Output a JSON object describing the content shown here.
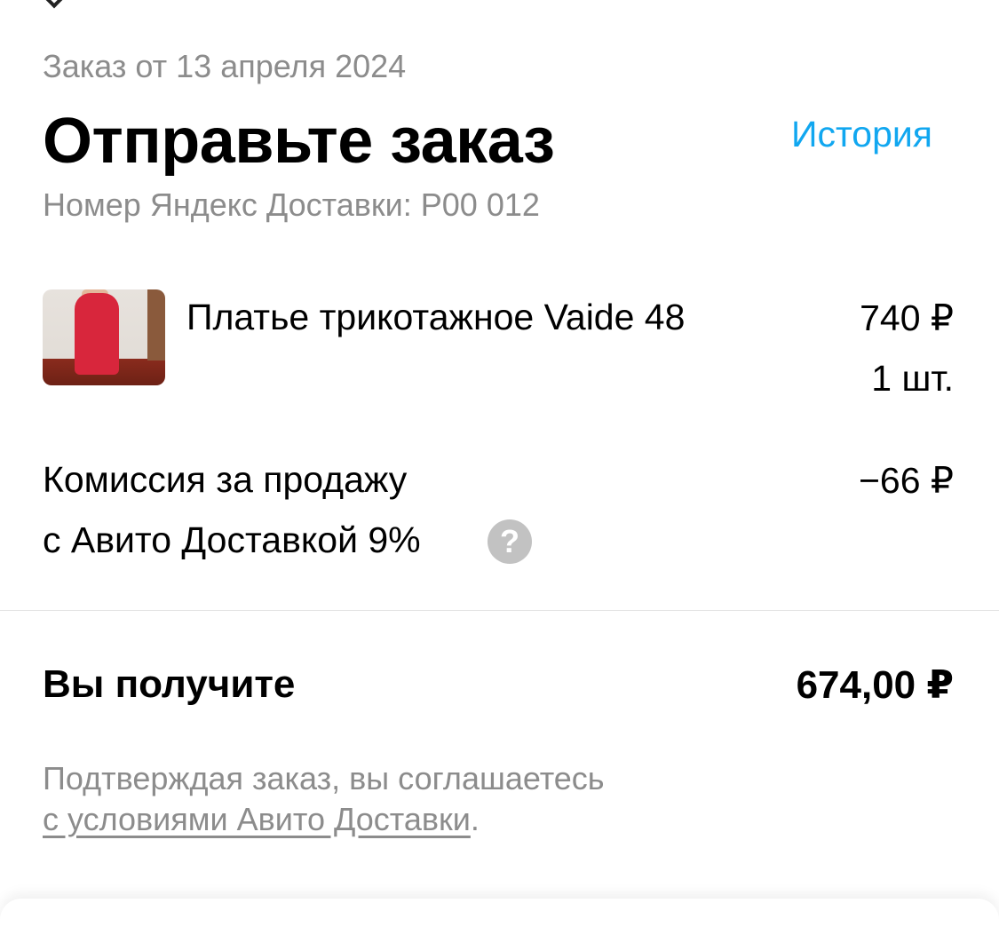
{
  "header": {
    "order_date": "Заказ от 13 апреля 2024",
    "title": "Отправьте заказ",
    "history_link": "История",
    "delivery_number": "Номер Яндекс Доставки: P00 012 "
  },
  "item": {
    "name": "Платье трикотажное Vaide 48",
    "price": "740 ₽",
    "quantity": "1 шт."
  },
  "commission": {
    "line1": "Комиссия за продажу",
    "line2": "с Авито Доставкой 9%",
    "amount": "−66 ₽",
    "help_icon": "?"
  },
  "total": {
    "label": "Вы получите",
    "amount": "674,00 ₽"
  },
  "agreement": {
    "line1": "Подтверждая заказ, вы соглашаетесь",
    "link_text": "с условиями Авито Доставки",
    "period": "."
  },
  "colors": {
    "accent_link": "#11a7f0",
    "muted_text": "#8c8c8c",
    "help_icon_bg": "#c2c2c2"
  }
}
